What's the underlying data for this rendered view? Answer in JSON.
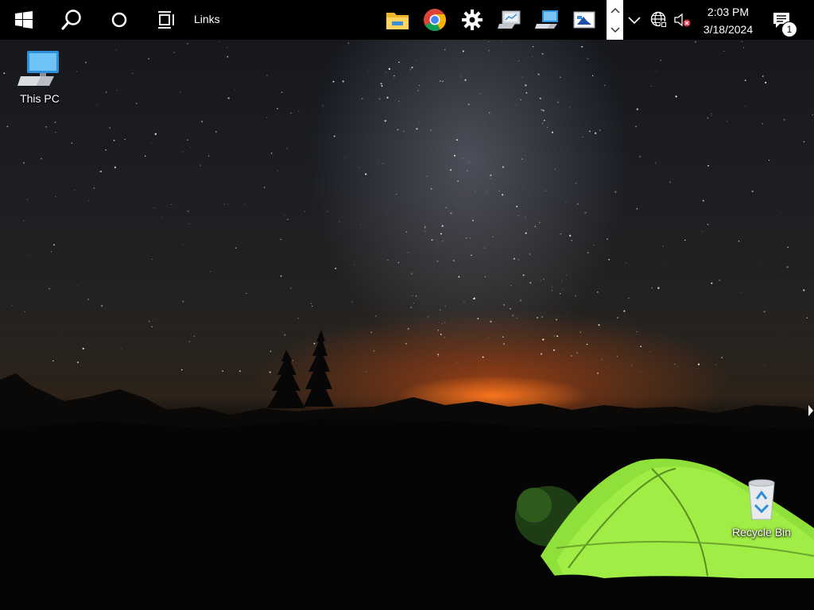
{
  "taskbar": {
    "links_label": "Links",
    "icons": {
      "start": "windows-logo-icon",
      "search": "search-icon",
      "cortana": "cortana-icon",
      "task_view": "task-view-icon",
      "file_explorer": "file-explorer-icon",
      "chrome": "chrome-icon",
      "settings": "settings-gear-icon",
      "control_panel": "control-panel-icon",
      "network_computer": "network-computer-icon",
      "remote_desktop": "remote-desktop-icon"
    }
  },
  "tray": {
    "time": "2:03 PM",
    "date": "3/18/2024",
    "notification_count": "1",
    "icons": {
      "overflow": "chevron-up-icon",
      "network": "globe-network-icon",
      "volume": "volume-muted-icon",
      "action_center": "action-center-icon"
    }
  },
  "desktop": {
    "icons": [
      {
        "label": "This PC",
        "icon": "this-pc-icon"
      },
      {
        "label": "Recycle Bin",
        "icon": "recycle-bin-icon"
      }
    ]
  },
  "colors": {
    "taskbar_bg": "#000000",
    "chrome_red": "#db4437",
    "chrome_yellow": "#f4b400",
    "chrome_green": "#0f9d58",
    "chrome_blue": "#4285f4",
    "tent_green": "#8fe03a",
    "horizon_orange": "#ff7a1e"
  }
}
